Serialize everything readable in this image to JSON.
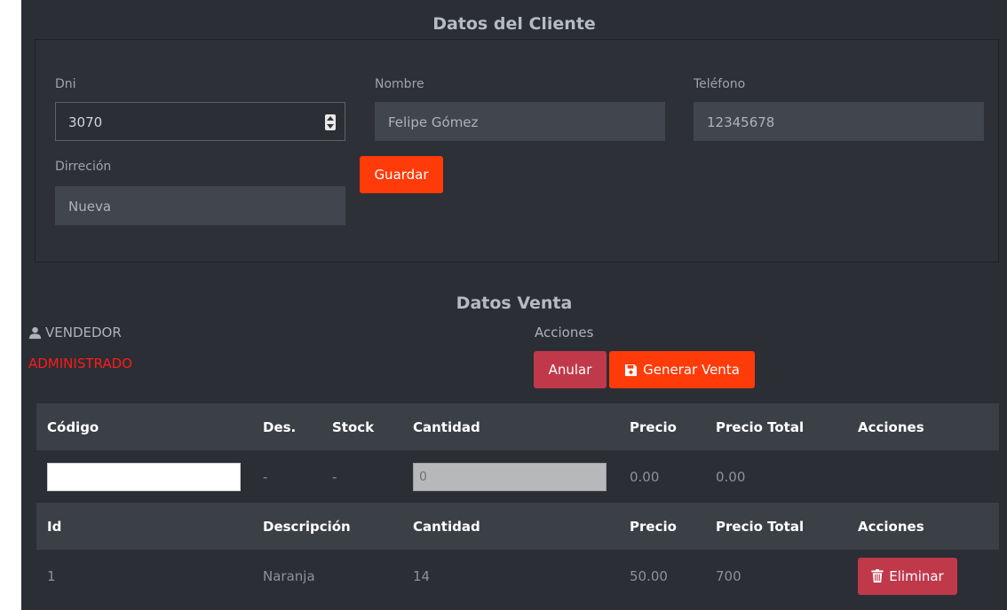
{
  "cliente": {
    "title": "Datos del Cliente",
    "dni": {
      "label": "Dni",
      "value": "3070"
    },
    "nombre": {
      "label": "Nombre",
      "value": "Felipe Gómez"
    },
    "telefono": {
      "label": "Teléfono",
      "value": "12345678"
    },
    "direccion": {
      "label": "Dirreción",
      "value": "Nueva"
    },
    "guardar_label": "Guardar"
  },
  "venta": {
    "title": "Datos Venta",
    "vendedor_label": "VENDEDOR",
    "vendedor_name": "ADMINISTRADO",
    "acciones_label": "Acciones",
    "anular_label": "Anular",
    "generar_label": "Generar Venta"
  },
  "entry_table": {
    "headers": [
      "Código",
      "Des.",
      "Stock",
      "Cantidad",
      "Precio",
      "Precio Total",
      "Acciones"
    ],
    "row": {
      "codigo": "",
      "des": "-",
      "stock": "-",
      "cantidad": "0",
      "precio": "0.00",
      "total": "0.00"
    }
  },
  "items_table": {
    "headers": [
      "Id",
      "Descripción",
      "Cantidad",
      "Precio",
      "Precio Total",
      "Acciones"
    ],
    "rows": [
      {
        "id": "1",
        "descripcion": "Naranja",
        "cantidad": "14",
        "precio": "50.00",
        "total": "700",
        "eliminar_label": "Eliminar"
      }
    ]
  },
  "colors": {
    "background": "#2b2e34",
    "accent_orange": "#ff3b0a",
    "danger_red": "#c0394b",
    "vendor_red": "#ff1a1a"
  },
  "icons": {
    "vendedor": "user-icon",
    "generar": "save-icon",
    "eliminar": "trash-icon"
  }
}
